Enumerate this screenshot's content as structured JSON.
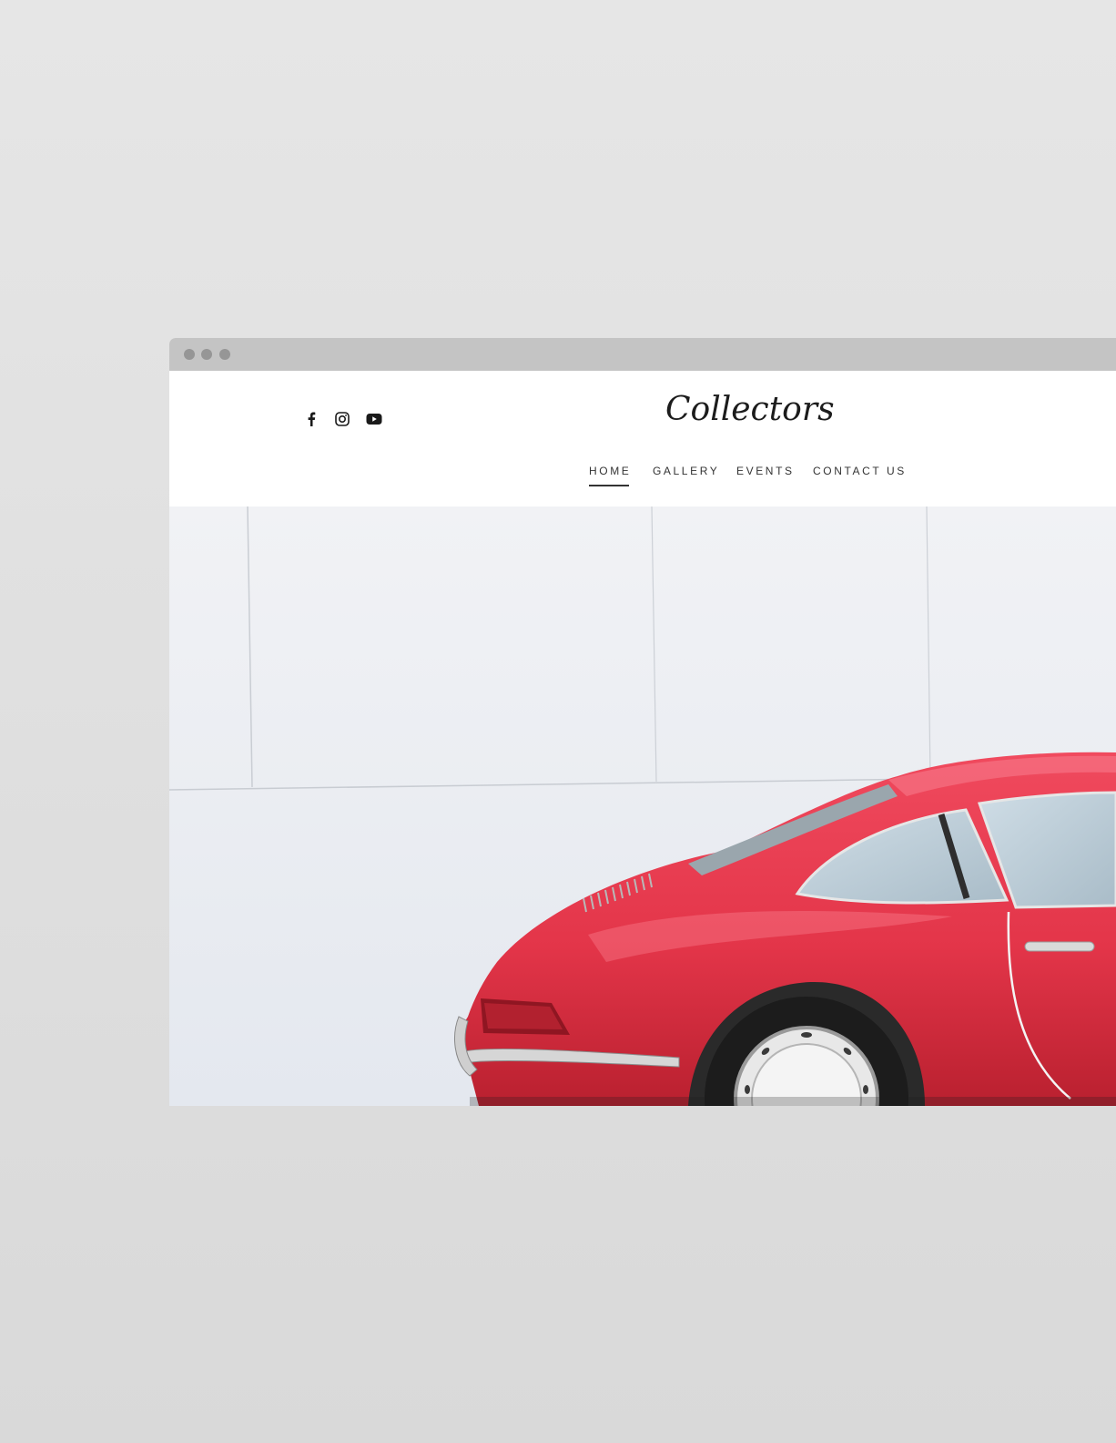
{
  "site": {
    "logo_text": "Collectors",
    "social_links": [
      {
        "icon": "facebook-icon"
      },
      {
        "icon": "instagram-icon"
      },
      {
        "icon": "youtube-icon"
      }
    ],
    "nav": [
      {
        "label": "HOME",
        "active": true
      },
      {
        "label": "GALLERY",
        "active": false
      },
      {
        "label": "EVENTS",
        "active": false
      },
      {
        "label": "CONTACT US",
        "active": false
      }
    ]
  },
  "hero": {
    "image_subject": "red classic coupe in front of pale wall"
  },
  "colors": {
    "page_background": "#e2e2e2",
    "titlebar": "#c4c4c4",
    "titlebar_dots": "#969696",
    "nav_text": "#333333",
    "car_red": "#e63a50",
    "wall": "#edf0f4"
  }
}
